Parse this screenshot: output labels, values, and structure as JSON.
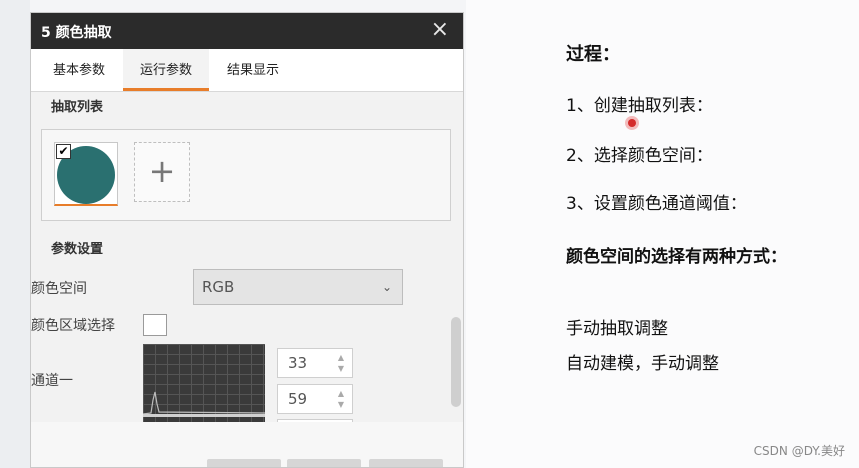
{
  "dialog": {
    "title": "5 颜色抽取",
    "close_icon": "×",
    "tabs": [
      {
        "label": "基本参数",
        "active": false
      },
      {
        "label": "运行参数",
        "active": true
      },
      {
        "label": "结果显示",
        "active": false
      }
    ],
    "extract_list": {
      "heading": "抽取列表",
      "items": [
        {
          "checked": true,
          "color": "#2a7070"
        }
      ],
      "add_icon": "+"
    },
    "params": {
      "heading": "参数设置",
      "color_space_label": "颜色空间",
      "color_space_value": "RGB",
      "region_select_label": "颜色区域选择",
      "channel1_label": "通道一",
      "channel1_values": [
        "33",
        "59"
      ]
    }
  },
  "notes": {
    "title": "过程：",
    "steps": [
      "1、创建抽取列表：",
      "2、选择颜色空间：",
      "3、设置颜色通道阈值："
    ],
    "bold_line": "颜色空间的选择有两种方式：",
    "methods": [
      "手动抽取调整",
      "自动建模，手动调整"
    ]
  },
  "watermark": "CSDN @DY.美好",
  "colors": {
    "accent": "#e87d2a",
    "titlebar": "#2b2b2b",
    "swatch": "#2a7070"
  }
}
